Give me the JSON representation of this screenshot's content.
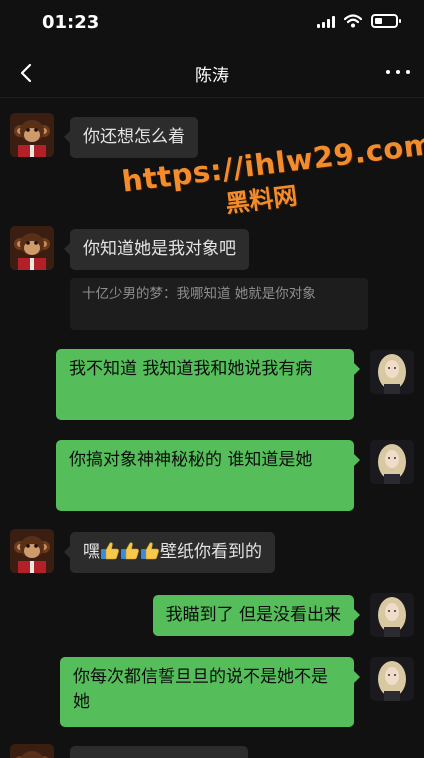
{
  "status_bar": {
    "time": "01:23",
    "battery_level": 0.35
  },
  "nav": {
    "title": "陈涛",
    "back_icon": "chevron-left-icon",
    "more_icon": "more-dots-icon"
  },
  "messages": [
    {
      "side": "in",
      "text": "你还想怎么着"
    },
    {
      "side": "in",
      "text": "你知道她是我对象吧",
      "quote": "十亿少男的梦：我哪知道 她就是你对象"
    },
    {
      "side": "out",
      "text": "我不知道 我知道我和她说我有病"
    },
    {
      "side": "out",
      "text": "你搞对象神神秘秘的 谁知道是她"
    },
    {
      "side": "in",
      "text_prefix": "嘿",
      "thumbs": 3,
      "thumb_icon": "thumbs-up-emoji-icon",
      "text_suffix": "壁纸你看到的"
    },
    {
      "side": "out",
      "text": "我瞄到了 但是没看出来"
    },
    {
      "side": "out",
      "text": "你每次都信誓旦旦的说不是她不是她"
    }
  ],
  "watermark": {
    "url": "https://ihlw29.com",
    "name": "黑料网"
  },
  "colors": {
    "background": "#111111",
    "incoming_bubble": "#2c2c2c",
    "outgoing_bubble": "#55bd5a",
    "watermark": "#f28c2c"
  }
}
